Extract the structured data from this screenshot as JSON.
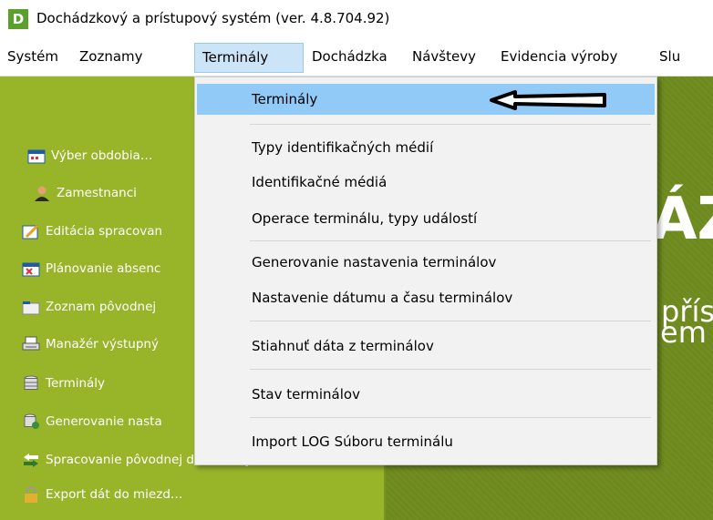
{
  "window": {
    "title": "Dochádzkový a prístupový systém (ver. 4.8.704.92)",
    "icon_letter": "D"
  },
  "menubar": {
    "items": [
      "Systém",
      "Zoznamy",
      "Terminály",
      "Dochádzka",
      "Návštevy",
      "Evidencia výroby",
      "Slu"
    ]
  },
  "sidebar": {
    "items": [
      "Výber obdobia…",
      "Zamestnanci",
      "Editácia spracovan",
      "Plánovanie absenc",
      "Zoznam pôvodnej",
      "Manažér výstupný",
      "Terminály",
      "Generovanie nasta",
      "Spracovanie pôvodnej dochádzky…",
      "Export dát do miezd…"
    ]
  },
  "main": {
    "big_letters": "ÁZ",
    "text1": "přís",
    "text2": "em"
  },
  "dropdown": {
    "items": [
      "Terminály",
      "Typy identifikačných médií",
      "Identifikačné médiá",
      "Operace terminálu, typy událostí",
      "Generovanie nastavenia terminálov",
      "Nastavenie dátumu a času terminálov",
      "Stiahnuť dáta z terminálov",
      "Stav terminálov",
      "Import LOG Súboru terminálu"
    ]
  },
  "colors": {
    "sidebar": "#98b52a",
    "main_bg": "#6e8a1e",
    "highlight": "#91c9f7",
    "app_icon": "#5aa02c"
  },
  "icons": [
    "calendar-icon",
    "person-icon",
    "edit-icon",
    "absence-calendar-icon",
    "folder-icon",
    "printer-icon",
    "database-icon",
    "database-gear-icon",
    "transfer-arrows-icon",
    "lock-icon",
    "arrow-annotation"
  ]
}
